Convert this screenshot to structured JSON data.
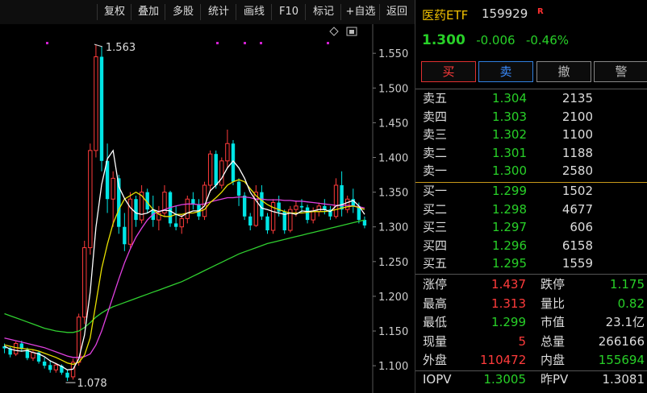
{
  "toolbar": {
    "buttons": [
      "复权",
      "叠加",
      "多股",
      "统计",
      "画线",
      "F10",
      "标记",
      "+自选",
      "返回"
    ]
  },
  "chart_data": {
    "type": "candlestick",
    "y_ticks": [
      "1.550",
      "1.500",
      "1.450",
      "1.400",
      "1.350",
      "1.300",
      "1.250",
      "1.200",
      "1.150",
      "1.100"
    ],
    "ylim": [
      1.07,
      1.585
    ],
    "annotations": {
      "high_label": "1.563",
      "low_label": "1.078"
    },
    "colors": {
      "up": "#ff3b3b",
      "down": "#00e5e5",
      "ma5": "#ffffff",
      "ma10": "#e8e000",
      "ma20": "#e040e0",
      "ma60": "#30d030"
    },
    "candles": [
      [
        1.128,
        1.132,
        1.118,
        1.125
      ],
      [
        1.125,
        1.127,
        1.112,
        1.116
      ],
      [
        1.117,
        1.135,
        1.114,
        1.132
      ],
      [
        1.132,
        1.136,
        1.12,
        1.124
      ],
      [
        1.123,
        1.126,
        1.108,
        1.111
      ],
      [
        1.111,
        1.122,
        1.107,
        1.119
      ],
      [
        1.119,
        1.121,
        1.103,
        1.106
      ],
      [
        1.106,
        1.112,
        1.096,
        1.1
      ],
      [
        1.101,
        1.108,
        1.09,
        1.094
      ],
      [
        1.094,
        1.104,
        1.09,
        1.101
      ],
      [
        1.1,
        1.102,
        1.087,
        1.09
      ],
      [
        1.09,
        1.095,
        1.078,
        1.083
      ],
      [
        1.084,
        1.11,
        1.08,
        1.105
      ],
      [
        1.105,
        1.175,
        1.1,
        1.17
      ],
      [
        1.17,
        1.28,
        1.16,
        1.27
      ],
      [
        1.27,
        1.42,
        1.26,
        1.41
      ],
      [
        1.41,
        1.563,
        1.4,
        1.545
      ],
      [
        1.545,
        1.56,
        1.38,
        1.395
      ],
      [
        1.395,
        1.42,
        1.32,
        1.34
      ],
      [
        1.34,
        1.38,
        1.3,
        1.37
      ],
      [
        1.37,
        1.375,
        1.29,
        1.3
      ],
      [
        1.3,
        1.32,
        1.265,
        1.275
      ],
      [
        1.275,
        1.35,
        1.27,
        1.34
      ],
      [
        1.34,
        1.345,
        1.3,
        1.31
      ],
      [
        1.31,
        1.36,
        1.305,
        1.35
      ],
      [
        1.35,
        1.355,
        1.32,
        1.325
      ],
      [
        1.325,
        1.345,
        1.3,
        1.31
      ],
      [
        1.31,
        1.33,
        1.295,
        1.32
      ],
      [
        1.32,
        1.36,
        1.315,
        1.35
      ],
      [
        1.35,
        1.352,
        1.3,
        1.305
      ],
      [
        1.305,
        1.33,
        1.295,
        1.3
      ],
      [
        1.3,
        1.318,
        1.29,
        1.312
      ],
      [
        1.312,
        1.345,
        1.305,
        1.34
      ],
      [
        1.34,
        1.35,
        1.325,
        1.332
      ],
      [
        1.332,
        1.34,
        1.31,
        1.315
      ],
      [
        1.315,
        1.365,
        1.31,
        1.36
      ],
      [
        1.36,
        1.41,
        1.35,
        1.405
      ],
      [
        1.405,
        1.41,
        1.355,
        1.36
      ],
      [
        1.36,
        1.4,
        1.355,
        1.395
      ],
      [
        1.395,
        1.44,
        1.385,
        1.42
      ],
      [
        1.42,
        1.425,
        1.36,
        1.365
      ],
      [
        1.365,
        1.37,
        1.33,
        1.345
      ],
      [
        1.345,
        1.35,
        1.31,
        1.315
      ],
      [
        1.315,
        1.32,
        1.295,
        1.302
      ],
      [
        1.302,
        1.36,
        1.3,
        1.35
      ],
      [
        1.35,
        1.36,
        1.31,
        1.315
      ],
      [
        1.315,
        1.32,
        1.29,
        1.295
      ],
      [
        1.295,
        1.34,
        1.29,
        1.335
      ],
      [
        1.335,
        1.345,
        1.315,
        1.322
      ],
      [
        1.322,
        1.325,
        1.29,
        1.295
      ],
      [
        1.295,
        1.33,
        1.292,
        1.325
      ],
      [
        1.325,
        1.338,
        1.315,
        1.33
      ],
      [
        1.33,
        1.34,
        1.32,
        1.328
      ],
      [
        1.328,
        1.332,
        1.305,
        1.31
      ],
      [
        1.31,
        1.328,
        1.305,
        1.322
      ],
      [
        1.322,
        1.335,
        1.315,
        1.33
      ],
      [
        1.33,
        1.34,
        1.318,
        1.325
      ],
      [
        1.325,
        1.33,
        1.31,
        1.315
      ],
      [
        1.315,
        1.37,
        1.312,
        1.36
      ],
      [
        1.36,
        1.38,
        1.315,
        1.325
      ],
      [
        1.325,
        1.345,
        1.32,
        1.34
      ],
      [
        1.34,
        1.355,
        1.32,
        1.33
      ],
      [
        1.33,
        1.335,
        1.305,
        1.31
      ],
      [
        1.31,
        1.315,
        1.298,
        1.302
      ]
    ],
    "ma5": [
      1.128,
      1.124,
      1.122,
      1.121,
      1.122,
      1.119,
      1.117,
      1.113,
      1.107,
      1.103,
      1.099,
      1.094,
      1.095,
      1.11,
      1.144,
      1.206,
      1.299,
      1.361,
      1.398,
      1.41,
      1.358,
      1.341,
      1.328,
      1.32,
      1.318,
      1.32,
      1.325,
      1.322,
      1.324,
      1.323,
      1.318,
      1.315,
      1.32,
      1.323,
      1.323,
      1.33,
      1.352,
      1.36,
      1.37,
      1.385,
      1.395,
      1.385,
      1.37,
      1.35,
      1.338,
      1.327,
      1.325,
      1.322,
      1.32,
      1.318,
      1.32,
      1.318,
      1.323,
      1.322,
      1.323,
      1.325,
      1.325,
      1.322,
      1.33,
      1.332,
      1.335,
      1.338,
      1.33,
      1.318
    ],
    "ma10": [
      1.13,
      1.128,
      1.126,
      1.125,
      1.124,
      1.123,
      1.121,
      1.118,
      1.115,
      1.112,
      1.108,
      1.104,
      1.102,
      1.105,
      1.115,
      1.14,
      1.19,
      1.24,
      1.275,
      1.305,
      1.325,
      1.34,
      1.345,
      1.35,
      1.345,
      1.335,
      1.325,
      1.318,
      1.315,
      1.315,
      1.318,
      1.318,
      1.32,
      1.32,
      1.322,
      1.325,
      1.335,
      1.342,
      1.35,
      1.36,
      1.365,
      1.368,
      1.365,
      1.355,
      1.345,
      1.338,
      1.332,
      1.328,
      1.325,
      1.322,
      1.32,
      1.32,
      1.32,
      1.321,
      1.322,
      1.322,
      1.322,
      1.323,
      1.325,
      1.327,
      1.329,
      1.33,
      1.328,
      1.325
    ],
    "ma20": [
      1.14,
      1.138,
      1.136,
      1.134,
      1.132,
      1.13,
      1.128,
      1.126,
      1.123,
      1.12,
      1.117,
      1.114,
      1.112,
      1.112,
      1.113,
      1.117,
      1.13,
      1.15,
      1.175,
      1.2,
      1.225,
      1.248,
      1.268,
      1.285,
      1.298,
      1.31,
      1.318,
      1.322,
      1.325,
      1.328,
      1.33,
      1.332,
      1.333,
      1.333,
      1.332,
      1.333,
      1.336,
      1.338,
      1.34,
      1.342,
      1.342,
      1.343,
      1.343,
      1.342,
      1.34,
      1.34,
      1.339,
      1.339,
      1.339,
      1.338,
      1.338,
      1.337,
      1.337,
      1.336,
      1.335,
      1.334,
      1.333,
      1.332,
      1.331,
      1.331,
      1.331,
      1.33,
      1.329,
      1.327
    ],
    "ma60": [
      1.175,
      1.172,
      1.169,
      1.166,
      1.163,
      1.16,
      1.157,
      1.154,
      1.152,
      1.15,
      1.149,
      1.148,
      1.148,
      1.15,
      1.155,
      1.162,
      1.17,
      1.176,
      1.181,
      1.185,
      1.188,
      1.191,
      1.194,
      1.197,
      1.2,
      1.203,
      1.206,
      1.209,
      1.212,
      1.215,
      1.218,
      1.221,
      1.225,
      1.229,
      1.233,
      1.237,
      1.241,
      1.245,
      1.249,
      1.253,
      1.257,
      1.261,
      1.264,
      1.267,
      1.27,
      1.273,
      1.276,
      1.278,
      1.28,
      1.282,
      1.284,
      1.286,
      1.288,
      1.29,
      1.292,
      1.294,
      1.296,
      1.298,
      1.3,
      1.302,
      1.304,
      1.306,
      1.308,
      1.31
    ]
  },
  "quote": {
    "title": "医药ETF",
    "code": "159929",
    "r_mark": "R",
    "last": "1.300",
    "change": "-0.006",
    "change_pct": "-0.46%"
  },
  "trade_buttons": [
    "买",
    "卖",
    "撤",
    "警"
  ],
  "asks": [
    {
      "label": "卖五",
      "price": "1.304",
      "vol": "2135"
    },
    {
      "label": "卖四",
      "price": "1.303",
      "vol": "2100"
    },
    {
      "label": "卖三",
      "price": "1.302",
      "vol": "1100"
    },
    {
      "label": "卖二",
      "price": "1.301",
      "vol": "1188"
    },
    {
      "label": "卖一",
      "price": "1.300",
      "vol": "2580"
    }
  ],
  "bids": [
    {
      "label": "买一",
      "price": "1.299",
      "vol": "1502"
    },
    {
      "label": "买二",
      "price": "1.298",
      "vol": "4677"
    },
    {
      "label": "买三",
      "price": "1.297",
      "vol": "606"
    },
    {
      "label": "买四",
      "price": "1.296",
      "vol": "6158"
    },
    {
      "label": "买五",
      "price": "1.295",
      "vol": "1559"
    }
  ],
  "stats": [
    {
      "l1": "涨停",
      "v1": "1.437",
      "c1": "red",
      "l2": "跌停",
      "v2": "1.175",
      "c2": "green"
    },
    {
      "l1": "最高",
      "v1": "1.313",
      "c1": "red",
      "l2": "量比",
      "v2": "0.82",
      "c2": "green"
    },
    {
      "l1": "最低",
      "v1": "1.299",
      "c1": "green",
      "l2": "市值",
      "v2": "23.1亿",
      "c2": "white"
    },
    {
      "l1": "现量",
      "v1": "5",
      "c1": "red",
      "l2": "总量",
      "v2": "266166",
      "c2": "white"
    },
    {
      "l1": "外盘",
      "v1": "110472",
      "c1": "red",
      "l2": "内盘",
      "v2": "155694",
      "c2": "green"
    },
    {
      "l1": "IOPV",
      "v1": "1.3005",
      "c1": "green",
      "l2": "昨PV",
      "v2": "1.3081",
      "c2": "white"
    }
  ]
}
